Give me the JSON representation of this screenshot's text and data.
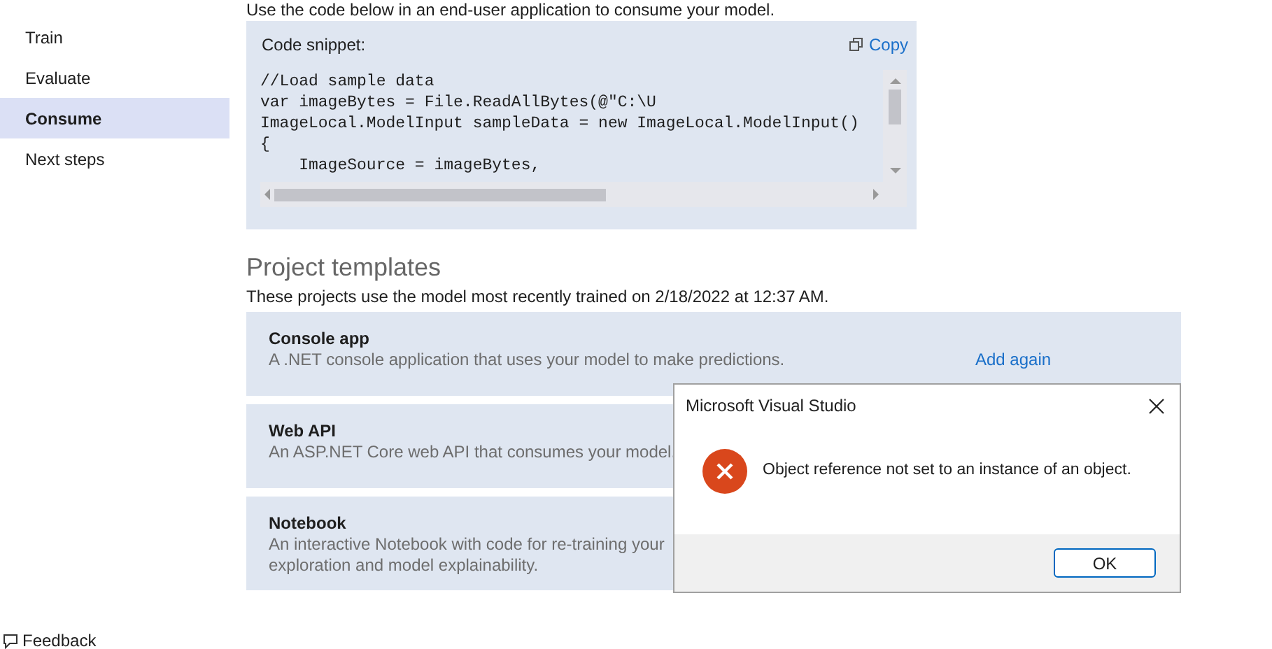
{
  "sidebar": {
    "items": [
      {
        "label": "Train",
        "selected": false
      },
      {
        "label": "Evaluate",
        "selected": false
      },
      {
        "label": "Consume",
        "selected": true
      },
      {
        "label": "Next steps",
        "selected": false
      }
    ],
    "feedback": "Feedback"
  },
  "intro": "Use the code below in an end-user application to consume your model.",
  "code_snippet": {
    "title": "Code snippet:",
    "copy": "Copy",
    "lines": [
      "//Load sample data",
      "var imageBytes = File.ReadAllBytes(@\"C:\\U",
      "ImageLocal.ModelInput sampleData = new ImageLocal.ModelInput()",
      "{",
      "    ImageSource = imageBytes,"
    ]
  },
  "project_templates": {
    "title": "Project templates",
    "subtitle": "These projects use the model most recently trained on 2/18/2022 at 12:37 AM.",
    "items": [
      {
        "name": "Console app",
        "description": [
          "A .NET console application that uses your model to make predictions."
        ],
        "action": "Add again"
      },
      {
        "name": "Web API",
        "description": [
          "An ASP.NET Core web API that consumes your model."
        ]
      },
      {
        "name": "Notebook",
        "description": [
          "An interactive Notebook with code for re-training your",
          "exploration and model explainability."
        ]
      }
    ]
  },
  "dialog": {
    "title": "Microsoft Visual Studio",
    "message": "Object reference not set to an instance of an object.",
    "buttons": [
      "OK"
    ]
  }
}
